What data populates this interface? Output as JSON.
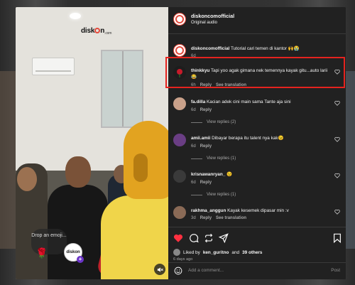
{
  "video": {
    "logo": {
      "main_before": "disk",
      "main_after": "n",
      "suffix": ".com"
    },
    "drop_emoji": "Drop an emoji...",
    "emoji_badge": "🌹",
    "avatar_bubble": {
      "text": "diskon",
      "plus": "+"
    }
  },
  "post": {
    "username": "diskoncomofficial",
    "audio": "Original audio"
  },
  "comments": [
    {
      "user": "diskoncomofficial",
      "text": "Tutorial cari temen di kantor 🙌😭",
      "time": "6d",
      "reply": "",
      "translate": ""
    },
    {
      "user": "thinkkyu",
      "text": "Tapi yoo agak gimana nek temennya kayak gitu...auto larii 😂",
      "time": "6h",
      "reply": "Reply",
      "translate": "See translation"
    },
    {
      "user": "fa.dilla",
      "text": "Kacian adek cini main sama Tante aja sini",
      "time": "6d",
      "reply": "Reply",
      "translate": "",
      "replies": "View replies (2)"
    },
    {
      "user": "amii.amii",
      "text": "Dibayar berapa itu talent nya kak😉",
      "time": "6d",
      "reply": "Reply",
      "translate": "",
      "replies": "View replies (1)"
    },
    {
      "user": "krisnawanryan_",
      "text": "😉",
      "time": "6d",
      "reply": "Reply",
      "translate": "",
      "replies": "View replies (1)"
    },
    {
      "user": "rakhma_anggun",
      "text": "Kayak kesemek dipasar min :v",
      "time": "3d",
      "reply": "Reply",
      "translate": "See translation"
    }
  ],
  "likes": {
    "prefix": "Liked by",
    "user": "ken_guritno",
    "and": "and",
    "others": "39 others"
  },
  "time_ago": "6 days ago",
  "add_comment": {
    "placeholder": "Add a comment...",
    "post": "Post"
  },
  "colors": {
    "like_red": "#ff3040",
    "highlight": "#e5231f",
    "brand": "#e34a3c"
  }
}
